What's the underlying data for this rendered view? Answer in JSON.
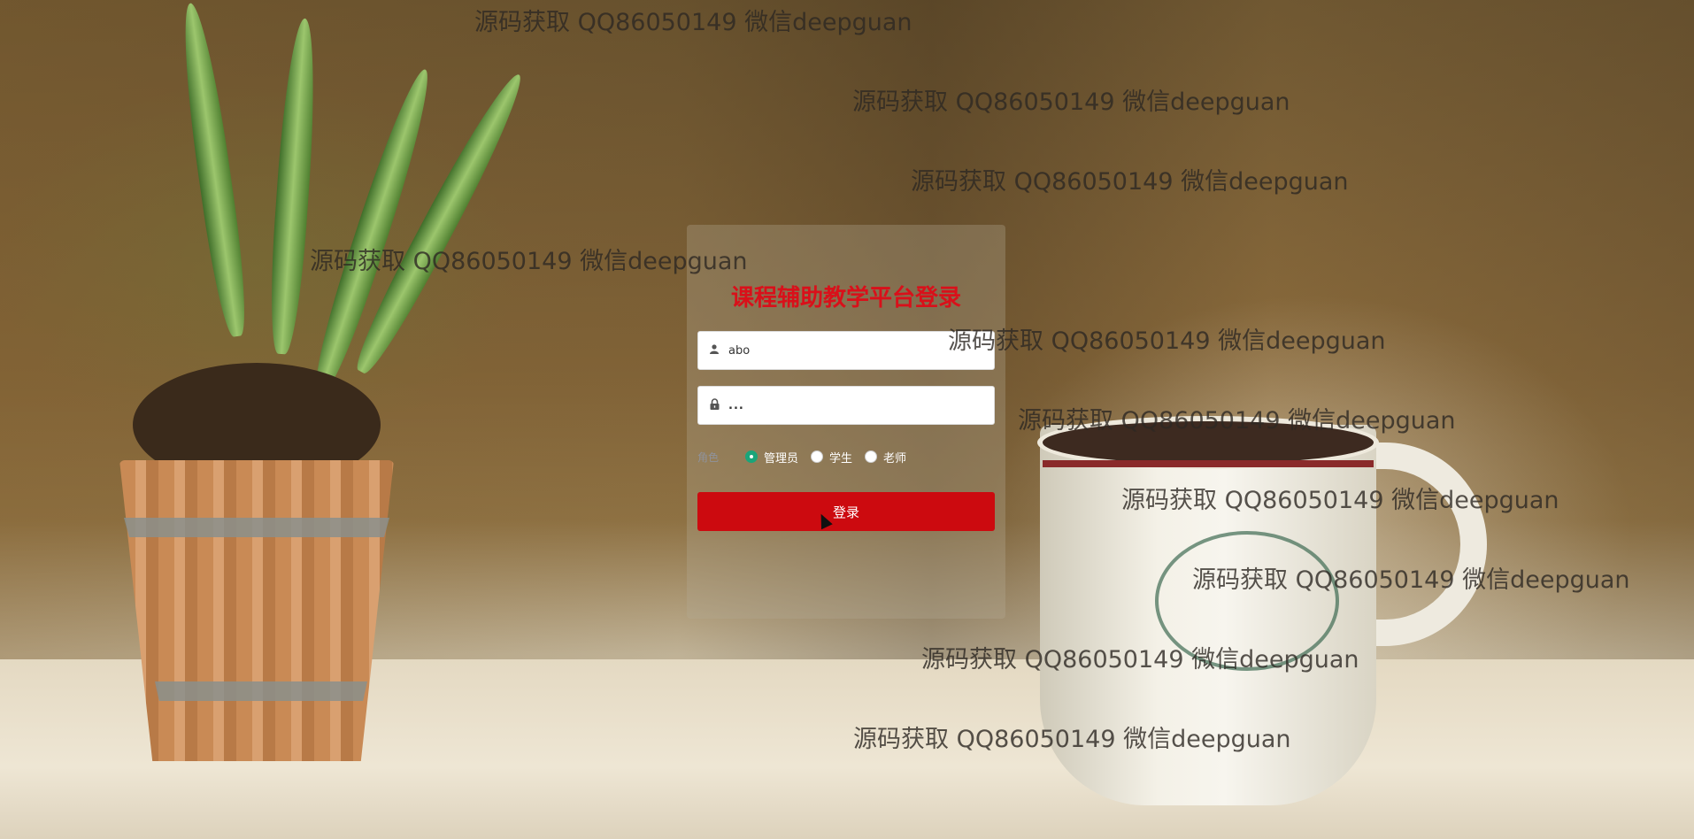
{
  "login": {
    "title": "课程辅助教学平台登录",
    "username_value": "abo",
    "password_value": "...",
    "role_label": "角色",
    "roles": [
      {
        "label": "管理员",
        "checked": true
      },
      {
        "label": "学生",
        "checked": false
      },
      {
        "label": "老师",
        "checked": false
      }
    ],
    "submit_label": "登录"
  },
  "watermarks": [
    "源码获取 QQ86050149 微信deepguan",
    "源码获取 QQ86050149 微信deepguan",
    "源码获取 QQ86050149 微信deepguan",
    "源码获取 QQ86050149 微信deepguan",
    "源码获取 QQ86050149 微信deepguan",
    "源码获取 QQ86050149 微信deepguan",
    "源码获取 QQ86050149 微信deepguan",
    "源码获取 QQ86050149 微信deepguan",
    "源码获取 QQ86050149 微信deepguan",
    "源码获取 QQ86050149 微信deepguan"
  ],
  "icons": {
    "username": "user-icon",
    "password": "lock-icon"
  },
  "colors": {
    "title": "#d9101a",
    "button": "#cc0a0f",
    "radio_checked": "#1aa57a"
  }
}
